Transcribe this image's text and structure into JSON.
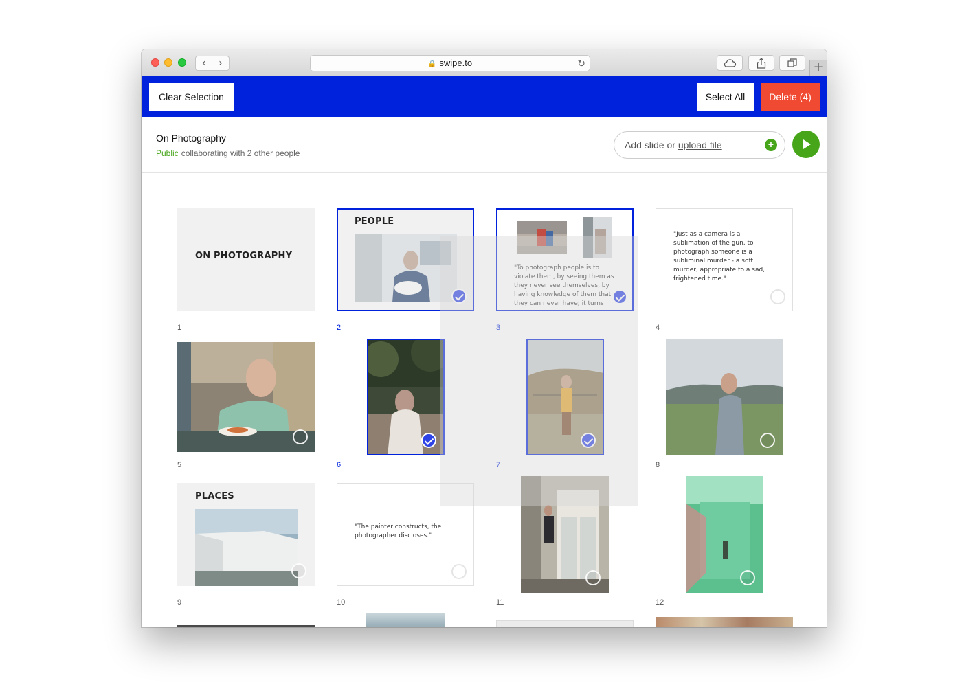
{
  "browser": {
    "url": "swipe.to",
    "back_glyph": "‹",
    "forward_glyph": "›",
    "new_tab_glyph": "+"
  },
  "toolbar": {
    "clear_label": "Clear Selection",
    "select_all_label": "Select All",
    "delete_label": "Delete (4)"
  },
  "deck": {
    "title": "On Photography",
    "visibility": "Public",
    "collab": "collaborating with 2 other people",
    "add_prefix": "Add slide or ",
    "add_link": "upload file",
    "add_plus": "+"
  },
  "slides": {
    "s1": {
      "num": "1",
      "title": "ON PHOTOGRAPHY"
    },
    "s2": {
      "num": "2",
      "title": "PEOPLE",
      "selected": true
    },
    "s3": {
      "num": "3",
      "quote": "\"To photograph people is to violate them, by seeing them as they never see themselves, by having knowledge of them that they can never have; it turns",
      "selected": true
    },
    "s4": {
      "num": "4",
      "quote": "\"Just as a camera is a sublimation of the gun, to photograph someone is a subliminal murder - a soft murder, appropriate to a sad, frightened time.\""
    },
    "s5": {
      "num": "5"
    },
    "s6": {
      "num": "6",
      "selected": true
    },
    "s7": {
      "num": "7",
      "selected": true
    },
    "s8": {
      "num": "8"
    },
    "s9": {
      "num": "9",
      "title": "PLACES"
    },
    "s10": {
      "num": "10",
      "quote": "\"The painter constructs, the photographer discloses.\""
    },
    "s11": {
      "num": "11"
    },
    "s12": {
      "num": "12"
    }
  },
  "colors": {
    "accent": "#0022dd",
    "delete": "#f04a32",
    "green": "#46a519"
  }
}
